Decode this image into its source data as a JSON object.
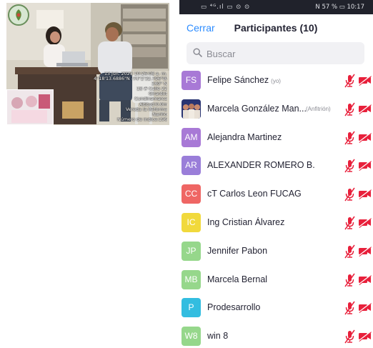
{
  "photo": {
    "stamp_lines": [
      "13 jun. 2023 10:26:08 a. m.",
      "4°18'13.6886\"N -74°2'32.796\"W",
      "340° N",
      "18 # Calle 22",
      "Girardot",
      "Cundinamarca",
      "Altitud:0.0m",
      "Vereda la Reforma",
      "Nariño",
      "Número de indice:196"
    ]
  },
  "statusbar": {
    "left": "▭ ⁴ᴳ.ıl ▭ ⊙ ⊙",
    "right": "N  57 % ▭ 10:17"
  },
  "header": {
    "close_label": "Cerrar",
    "title": "Participantes (10)"
  },
  "search": {
    "placeholder": "Buscar"
  },
  "colors": {
    "accent": "#2d8cff",
    "muted_icon": "#e8203b"
  },
  "participants": [
    {
      "initials": "FS",
      "name": "Felipe Sánchez",
      "role": "(yo)",
      "color": "#a879d6",
      "photo": false
    },
    {
      "initials": "",
      "name": "Marcela González Man...",
      "role_host": "(Anfitrión)",
      "color": "#3d4a8f",
      "photo": true
    },
    {
      "initials": "AM",
      "name": "Alejandra Martinez",
      "role": "",
      "color": "#a879d6",
      "photo": false
    },
    {
      "initials": "AR",
      "name": "ALEXANDER ROMERO B.",
      "role": "",
      "color": "#9a7ed9",
      "photo": false
    },
    {
      "initials": "CC",
      "name": "cT Carlos Leon FUCAG",
      "role": "",
      "color": "#ef6664",
      "photo": false
    },
    {
      "initials": "IC",
      "name": "Ing Cristian Álvarez",
      "role": "",
      "color": "#f1d93c",
      "photo": false
    },
    {
      "initials": "JP",
      "name": "Jennifer Pabon",
      "role": "",
      "color": "#96d78b",
      "photo": false
    },
    {
      "initials": "MB",
      "name": "Marcela Bernal",
      "role": "",
      "color": "#96d78b",
      "photo": false
    },
    {
      "initials": "P",
      "name": "Prodesarrollo",
      "role": "",
      "color": "#33bde0",
      "photo": false
    },
    {
      "initials": "W8",
      "name": "win 8",
      "role": "",
      "color": "#96d78b",
      "photo": false
    }
  ]
}
